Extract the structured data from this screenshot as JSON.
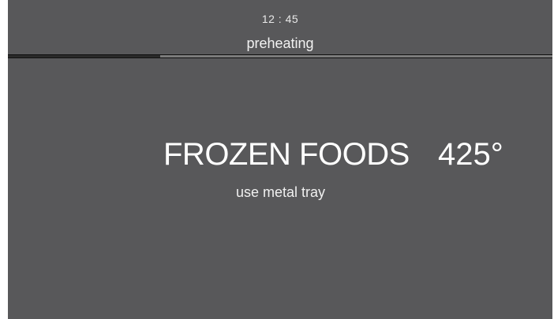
{
  "header": {
    "time": "12 : 45",
    "status": "preheating",
    "progress": 0.28
  },
  "main": {
    "mode": "FROZEN FOODS",
    "temperature": "425°",
    "instruction": "use metal tray"
  },
  "colors": {
    "background": "#58585a",
    "text": "#ffffff",
    "progress_track": "#101010",
    "progress_fill": "#2a2a2a",
    "progress_rest": "#7c7c7c"
  }
}
